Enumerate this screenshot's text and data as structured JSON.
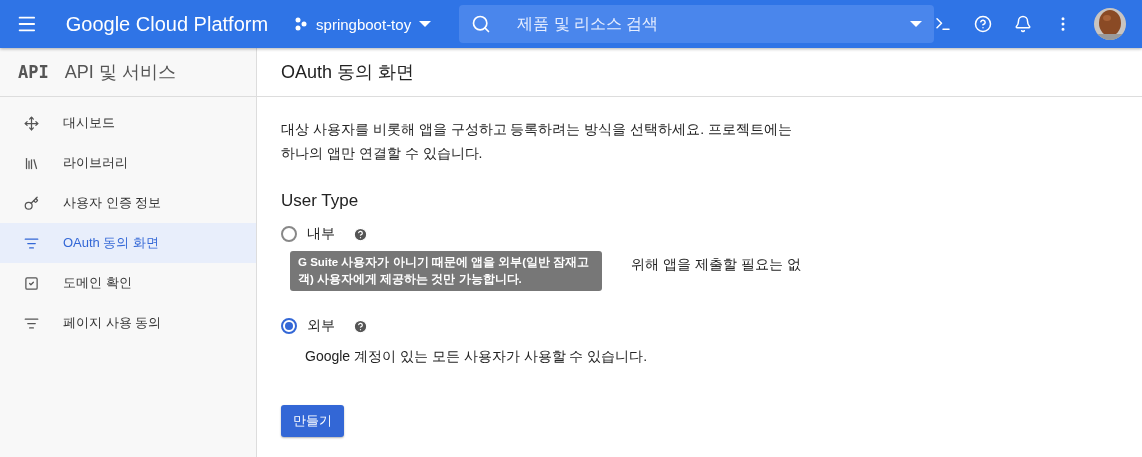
{
  "topbar": {
    "title": "Google Cloud Platform",
    "project": "springboot-toy",
    "search": {
      "placeholder": "제품 및 리소스 검색"
    }
  },
  "sidebar": {
    "logo": "API",
    "title": "API 및 서비스",
    "items": [
      {
        "label": "대시보드",
        "selected": false
      },
      {
        "label": "라이브러리",
        "selected": false
      },
      {
        "label": "사용자 인증 정보",
        "selected": false
      },
      {
        "label": "OAuth 동의 화면",
        "selected": true
      },
      {
        "label": "도메인 확인",
        "selected": false
      },
      {
        "label": "페이지 사용 동의",
        "selected": false
      }
    ]
  },
  "page": {
    "title": "OAuth 동의 화면",
    "intro": "대상 사용자를 비롯해 앱을 구성하고 등록하려는 방식을 선택하세요. 프로젝트에는 하나의 앱만 연결할 수 있습니다.",
    "section": "User Type",
    "options": [
      {
        "label": "내부",
        "selected": false,
        "description": "위해 앱을 제출할 필요는 없"
      },
      {
        "label": "외부",
        "selected": true,
        "description": "Google 계정이 있는 모든 사용자가 사용할 수 있습니다."
      }
    ],
    "tooltip": "G Suite 사용자가 아니기 때문에 앱을 외부(일반 잠재고객) 사용자에게 제공하는 것만 가능합니다.",
    "create_button": "만들기"
  }
}
